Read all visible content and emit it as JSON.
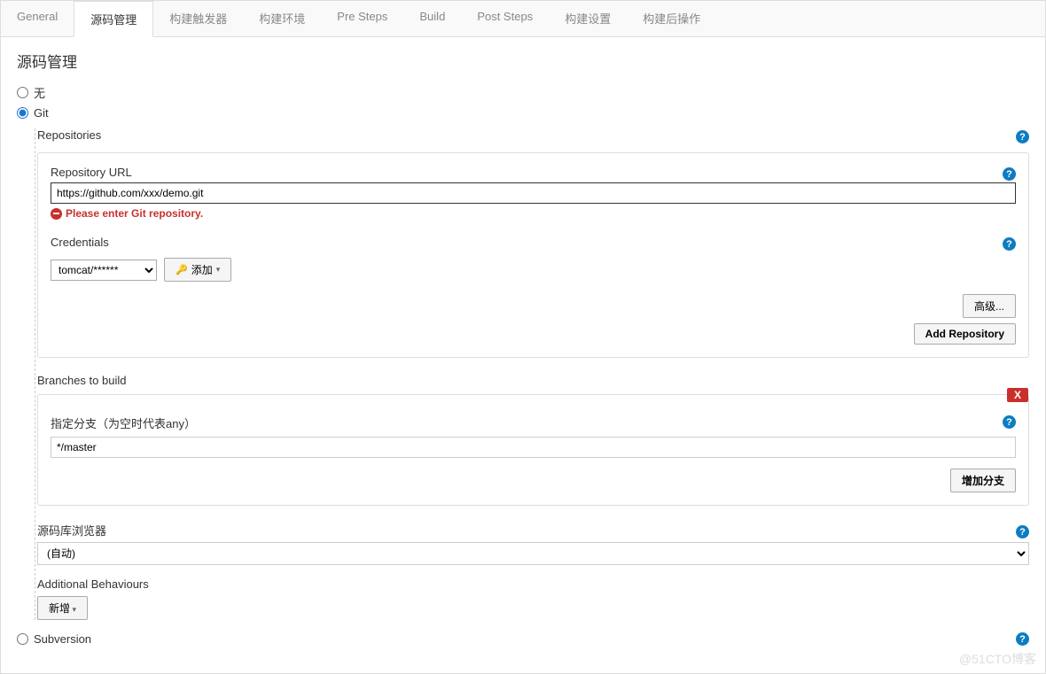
{
  "tabs": [
    "General",
    "源码管理",
    "构建触发器",
    "构建环境",
    "Pre Steps",
    "Build",
    "Post Steps",
    "构建设置",
    "构建后操作"
  ],
  "activeTab": 1,
  "sectionTitle": "源码管理",
  "scm": {
    "noneLabel": "无",
    "gitLabel": "Git",
    "subversionLabel": "Subversion",
    "repositoriesLabel": "Repositories",
    "repoUrlLabel": "Repository URL",
    "repoUrlValue": "https://github.com/xxx/demo.git",
    "repoUrlError": "Please enter Git repository.",
    "credentialsLabel": "Credentials",
    "credentialsValue": "tomcat/******",
    "addButton": "添加",
    "advancedButton": "高级...",
    "addRepoButton": "Add Repository",
    "branchesLabel": "Branches to build",
    "branchSpecLabel": "指定分支（为空时代表any）",
    "branchSpecValue": "*/master",
    "deleteLabel": "X",
    "addBranchButton": "增加分支",
    "repoBrowserLabel": "源码库浏览器",
    "repoBrowserValue": "(自动)",
    "additionalBehavioursLabel": "Additional Behaviours",
    "addBehaviourButton": "新增"
  },
  "watermark": "@51CTO博客"
}
